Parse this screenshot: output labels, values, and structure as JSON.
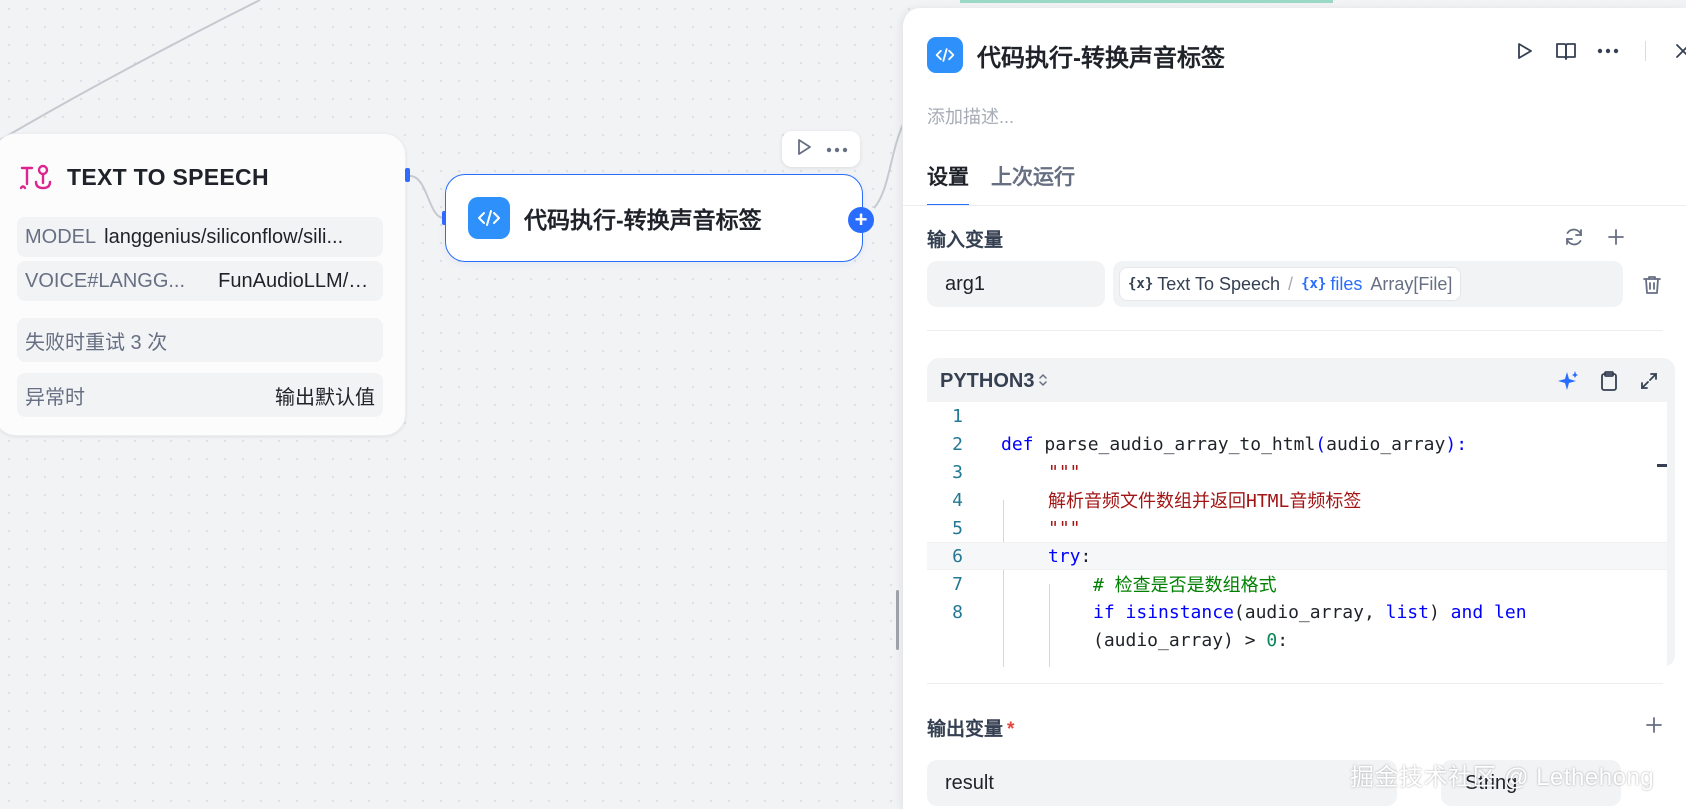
{
  "canvas": {
    "tts_node": {
      "title": "TEXT TO SPEECH",
      "model_label": "MODEL",
      "model_value": "langgenius/siliconflow/sili...",
      "voice_label": "VOICE#LANGG...",
      "voice_value": "FunAudioLLM/C...",
      "retry_text": "失败时重试 3 次",
      "exception_label": "异常时",
      "exception_value": "输出默认值"
    },
    "code_node": {
      "title": "代码执行-转换声音标签"
    }
  },
  "panel": {
    "title": "代码执行-转换声音标签",
    "description_placeholder": "添加描述...",
    "tabs": [
      {
        "label": "设置",
        "active": true
      },
      {
        "label": "上次运行",
        "active": false
      }
    ],
    "input_section": {
      "label": "输入变量",
      "variables": [
        {
          "name": "arg1",
          "source_node": "Text To Speech",
          "separator": "/",
          "variable": "files",
          "type": "Array[File]"
        }
      ]
    },
    "code": {
      "language": "PYTHON3",
      "lines": [
        {
          "n": "1"
        },
        {
          "n": "2"
        },
        {
          "n": "3"
        },
        {
          "n": "4"
        },
        {
          "n": "5"
        },
        {
          "n": "6"
        },
        {
          "n": "7"
        },
        {
          "n": "8"
        }
      ],
      "text": {
        "l2_def": "def",
        "l2_name": "parse_audio_array_to_html",
        "l2_paren_open": "(",
        "l2_param": "audio_array",
        "l2_paren_close": "):",
        "l3": "\"\"\"",
        "l4": "解析音频文件数组并返回HTML音频标签",
        "l5": "\"\"\"",
        "l6_try": "try",
        "l6_colon": ":",
        "l7": "# 检查是否是数组格式",
        "l8_if": "if",
        "l8_isinstance": "isinstance",
        "l8_args": "(audio_array, ",
        "l8_list": "list",
        "l8_close": ") ",
        "l8_and": "and",
        "l8_len": "len",
        "l9_a": "(audio_array) > ",
        "l9_zero": "0",
        "l9_colon": ":"
      }
    },
    "output_section": {
      "label": "输出变量",
      "required_mark": "*",
      "variables": [
        {
          "name": "result",
          "type": "String"
        }
      ]
    }
  },
  "watermark": "掘金技术社区 @ Lethehong",
  "colors": {
    "accent": "#296dff",
    "node_icon": "#2e90fa",
    "tts_icon": "#dd2590"
  }
}
